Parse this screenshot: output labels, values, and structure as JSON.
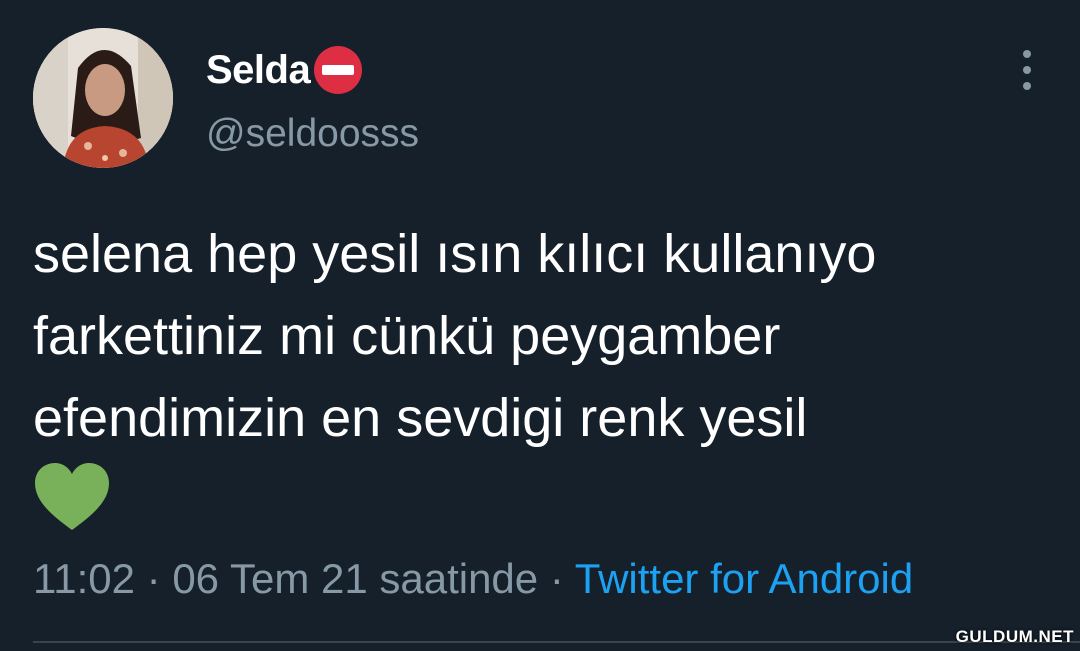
{
  "tweet": {
    "display_name": "Selda",
    "name_emoji": "no-entry-icon",
    "handle": "@seldoosss",
    "text_lines": [
      "selena hep yesil ısın kılıcı kullanıyo",
      "farkettiniz mi cünkü peygamber",
      "efendimizin en sevdigi renk yesil"
    ],
    "text_emoji": "green-heart-icon",
    "time": "11:02",
    "date_text": "06 Tem 21 saatinde",
    "separator": " · ",
    "source": "Twitter for Android"
  },
  "colors": {
    "background": "#15202b",
    "text": "#ffffff",
    "secondary": "#8899a6",
    "link": "#1da1f2",
    "heart": "#78b159",
    "no_entry": "#dd2e44"
  },
  "watermark": "GULDUM.NET"
}
